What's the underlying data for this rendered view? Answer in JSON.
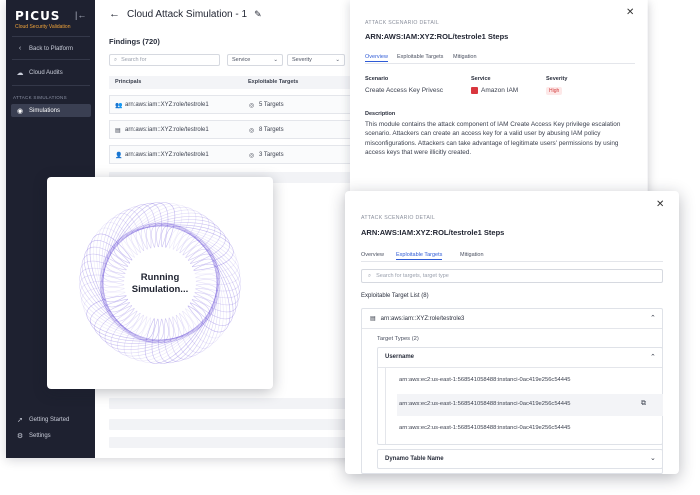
{
  "sidebar": {
    "brand": "PICUS",
    "brand_sub": "Cloud Security Validation",
    "back_label": "Back to Platform",
    "cloud_audits": "Cloud Audits",
    "section_label": "ATTACK SIMULATIONS",
    "simulations": "Simulations",
    "getting_started": "Getting Started",
    "settings": "Settings"
  },
  "page": {
    "title": "Cloud Attack Simulation - 1",
    "findings": "Findings (720)",
    "search_placeholder": "Search for",
    "filter_service": "Service",
    "filter_severity": "Severity"
  },
  "table": {
    "col_principals": "Principals",
    "col_targets": "Exploitable Targets",
    "rows": [
      {
        "principal": "arn:aws:iam::XYZ:role/testrole1",
        "targets": "5 Targets"
      },
      {
        "principal": "arn:aws:iam::XYZ:role/testrole1",
        "targets": "8 Targets"
      },
      {
        "principal": "arn:aws:iam::XYZ:role/testrole1",
        "targets": "3 Targets"
      }
    ]
  },
  "detail": {
    "label": "ATTACK SCENARIO DETAIL",
    "title": "ARN:AWS:IAM:XYZ:ROL/testrole1 Steps",
    "tabs": [
      "Overview",
      "Exploitable Targets",
      "Mitigation"
    ],
    "scenario_h": "Scenario",
    "scenario_v": "Create Access Key Privesc",
    "service_h": "Service",
    "service_v": "Amazon IAM",
    "severity_h": "Severity",
    "severity_v": "High",
    "description_h": "Description",
    "description": "This module contains the attack component of IAM Create Access Key privilege escalation scenario. Attackers can create an access key for a valid user by abusing IAM policy misconfigurations. Attackers can take advantage of legitimate users' permissions by using access keys that were illicitly created."
  },
  "simulation": {
    "line1": "Running",
    "line2": "Simulation..."
  },
  "exploit": {
    "label": "ATTACK SCENARIO DETAIL",
    "title": "ARN:AWS:IAM:XYZ:ROL/testrole1 Steps",
    "tabs": [
      "Overview",
      "Exploitable Targets",
      "Mitigation"
    ],
    "search_placeholder": "Search for targets, target type",
    "list_label": "Exploitable Target List (8)",
    "role": "arn:aws:iam::XYZ:role/testrole3",
    "types_label": "Target Types (2)",
    "type1": "Username",
    "arns": [
      "arn:aws:ec2:us-east-1:568541058488:instanci-0ac419e256c54445",
      "arn:aws:ec2:us-east-1:568541058488:instanci-0ac419e256c54445",
      "arn:aws:ec2:us-east-1:568541058488:instanci-0ac419e256c54445"
    ],
    "type2": "Dynamo Table Name"
  },
  "colors": {
    "sidebar_bg": "#1e2130",
    "accent": "#2f5bd6",
    "brand_accent": "#f0a33a",
    "severity_high": "#d23b3b",
    "spiral": "#6a4fd8"
  }
}
